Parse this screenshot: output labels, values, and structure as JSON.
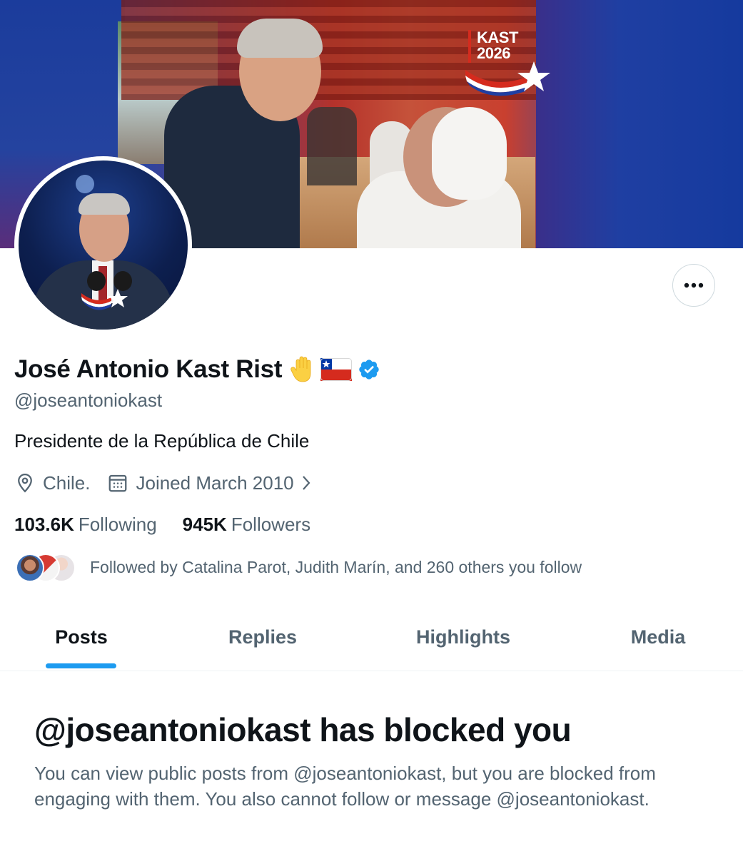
{
  "banner": {
    "campaign_logo": {
      "text": "KAST\n2026",
      "colors": {
        "red": "#d52b1e",
        "blue": "#1f3fa2",
        "white": "#ffffff"
      }
    }
  },
  "profile": {
    "display_name": "José Antonio Kast Rist",
    "name_icons": [
      "raised-hand-emoji",
      "chile-flag-emoji",
      "verified-badge-icon"
    ],
    "handle": "@joseantoniokast",
    "bio": "Presidente de la República de Chile",
    "location": "Chile.",
    "joined": "Joined March 2010",
    "following_count": "103.6K",
    "following_label": "Following",
    "followers_count": "945K",
    "followers_label": "Followers",
    "followed_by_text": "Followed by Catalina Parot, Judith Marín, and 260 others you follow"
  },
  "actions": {
    "more_icon": "ellipsis-icon"
  },
  "tabs": [
    {
      "label": "Posts",
      "active": true
    },
    {
      "label": "Replies",
      "active": false
    },
    {
      "label": "Highlights",
      "active": false
    },
    {
      "label": "Media",
      "active": false
    }
  ],
  "blocked": {
    "title": "@joseantoniokast has blocked you",
    "description": "You can view public posts from @joseantoniokast, but you are blocked from engaging with them. You also cannot follow or message @joseantoniokast."
  },
  "colors": {
    "accent": "#1d9bf0",
    "text_primary": "#0f1419",
    "text_secondary": "#536471",
    "verified": "#1d9bf0"
  }
}
